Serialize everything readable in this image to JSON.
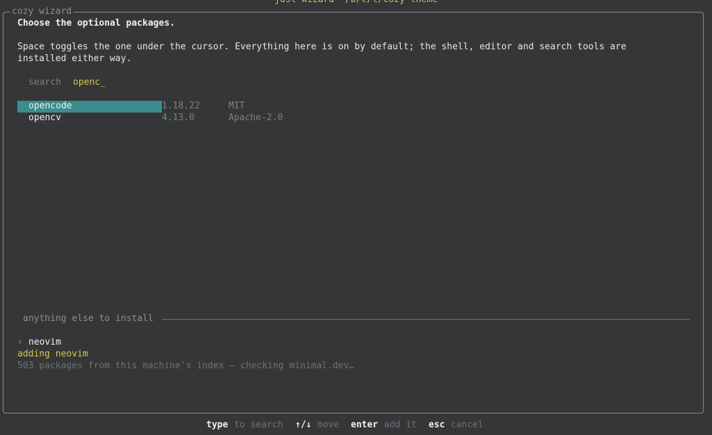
{
  "terminal": {
    "title": "just wizard ~/b/c/t/cozy-theme"
  },
  "frame": {
    "title": "cozy wizard"
  },
  "heading": "Choose the optional packages.",
  "description": "Space toggles the one under the cursor. Everything here is on by default; the shell, editor and search tools are\ninstalled either way.",
  "search": {
    "label": "search",
    "value": "openc_"
  },
  "packages": [
    {
      "name": "opencode",
      "version": "1.18.22",
      "license": "MIT",
      "selected": true
    },
    {
      "name": "opencv",
      "version": "4.13.0",
      "license": "Apache-2.0",
      "selected": false
    }
  ],
  "extra": {
    "section_label": "anything else to install",
    "prompt_symbol": "›",
    "input_value": "neovim",
    "adding_message": "adding neovim",
    "status_message": "503 packages from this machine's index — checking minimal.dev…"
  },
  "footer": {
    "hints": [
      {
        "key": "type",
        "action": "to search"
      },
      {
        "key": "↑/↓",
        "action": "move"
      },
      {
        "key": "enter",
        "action": "add it"
      },
      {
        "key": "esc",
        "action": "cancel"
      }
    ]
  },
  "colors": {
    "background": "#343638",
    "selection": "#3b8c8c",
    "accent_yellow": "#d7c84a",
    "muted": "#7d8084",
    "border": "#8a8d90"
  }
}
